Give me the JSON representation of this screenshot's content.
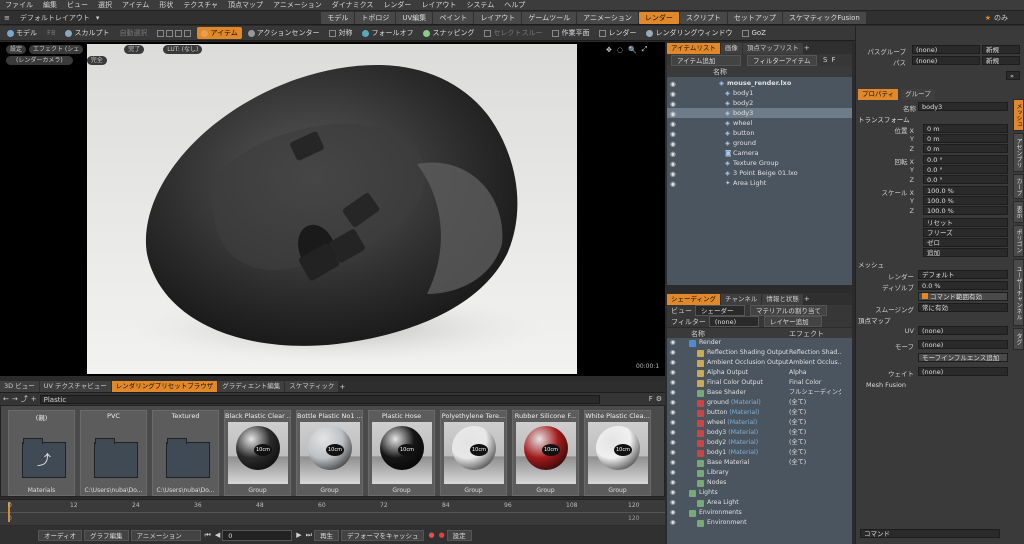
{
  "menubar": [
    "ファイル",
    "編集",
    "ビュー",
    "選択",
    "アイテム",
    "形状",
    "テクスチャ",
    "頂点マップ",
    "アニメーション",
    "ダイナミクス",
    "レンダー",
    "レイアウト",
    "システム",
    "ヘルプ"
  ],
  "layout": {
    "name": "デフォルトレイアウト",
    "tabs": [
      "モデル",
      "トポロジ",
      "UV編集",
      "ペイント",
      "レイアウト",
      "ゲームツール",
      "アニメーション",
      "レンダー",
      "スクリプト",
      "セットアップ",
      "スケマティックFusion"
    ],
    "active_tab": "レンダー",
    "right": "のみ"
  },
  "toolbar": {
    "model": "モデル",
    "f": "F8",
    "sculpt": "スカルプト",
    "auto": "自動選択",
    "item": "アイテム",
    "action_center": "アクションセンター",
    "symmetry": "対称",
    "falloff": "フォールオフ",
    "snapping": "スナッピング",
    "select_through": "セレクトスルー",
    "work_plane": "作業平面",
    "render": "レンダー",
    "render_window": "レンダリングウィンドウ",
    "goz": "GoZ"
  },
  "viewport": {
    "settings": "設定",
    "effect": "エフェクト (シェ",
    "complete": "完了",
    "lut": "LUT: (なし)",
    "camera": "(レンダーカメラ)",
    "full": "完全",
    "time": "00:00:1"
  },
  "bottom_tabs": [
    "3D ビュー",
    "UV テクスチャビュー",
    "レンダリングプリセットブラウザ",
    "グラディエント編集",
    "スケマティック"
  ],
  "bottom_active": "レンダリングプリセットブラウザ",
  "path": "Plastic",
  "presets": [
    {
      "title": "(親)",
      "caption": "Materials",
      "kind": "up"
    },
    {
      "title": "PVC",
      "caption": "C:\\Users\\nuba\\Do...",
      "kind": "folder"
    },
    {
      "title": "Textured",
      "caption": "C:\\Users\\nuba\\Do...",
      "kind": "folder"
    },
    {
      "title": "Black Plastic Clear ...",
      "caption": "Group",
      "kind": "sphere",
      "color": "#2a2a2a"
    },
    {
      "title": "Bottle Plastic No1 ...",
      "caption": "Group",
      "kind": "sphere",
      "color": "#bfc3c6"
    },
    {
      "title": "Plastic Hose",
      "caption": "Group",
      "kind": "sphere",
      "color": "#151515"
    },
    {
      "title": "Polyethylene Tere...",
      "caption": "Group",
      "kind": "sphere",
      "color": "#e8e8e8"
    },
    {
      "title": "Rubber Silicone F...",
      "caption": "Group",
      "kind": "sphere",
      "color": "#a11b1b"
    },
    {
      "title": "White Plastic Clea...",
      "caption": "Group",
      "kind": "sphere",
      "color": "#f0f0f0"
    }
  ],
  "thumb_label": "10cm",
  "timeline": {
    "ticks": [
      "0",
      "12",
      "24",
      "36",
      "48",
      "60",
      "72",
      "84",
      "96",
      "108",
      "120"
    ],
    "sub": [
      "0",
      "",
      "",
      "",
      "",
      "",
      "",
      "",
      "",
      "",
      "120"
    ]
  },
  "statusbar": {
    "audio": "オーディオ",
    "graph": "グラフ編集",
    "anim": "アニメーション",
    "frame": "0",
    "play": "再生",
    "cache": "デフォーマをキャッシュ",
    "settings": "設定"
  },
  "itemlist": {
    "tabs": [
      "アイテムリスト",
      "画像",
      "頂点マップリスト"
    ],
    "add": "アイテム追加",
    "filter": "フィルターアイテム",
    "col_name": "名称",
    "rows": [
      {
        "name": "mouse_render.lxo",
        "indent": 0,
        "bold": true
      },
      {
        "name": "body1",
        "indent": 1
      },
      {
        "name": "body2",
        "indent": 1
      },
      {
        "name": "body3",
        "indent": 1,
        "selected": true
      },
      {
        "name": "wheel",
        "indent": 1
      },
      {
        "name": "button",
        "indent": 1
      },
      {
        "name": "ground",
        "indent": 1
      },
      {
        "name": "Camera",
        "indent": 1
      },
      {
        "name": "Texture Group",
        "indent": 1
      },
      {
        "name": "3 Point Beige 01.lxo",
        "indent": 1
      },
      {
        "name": "Area Light",
        "indent": 1
      }
    ]
  },
  "shading": {
    "tabs": [
      "シェーディング",
      "チャンネル",
      "情報と状態"
    ],
    "view_lbl": "ビュー",
    "view": "シェーダーツリー",
    "assign": "マテリアルの割り当て",
    "filter_lbl": "フィルター",
    "filter": "(none)",
    "layer_add": "レイヤー追加",
    "col_name": "名称",
    "col_effect": "エフェクト",
    "rows": [
      {
        "name": "Render",
        "fx": "",
        "indent": 0
      },
      {
        "name": "Reflection Shading Output",
        "fx": "Reflection Shad...",
        "indent": 1
      },
      {
        "name": "Ambient Occlusion Output",
        "fx": "Ambient Occlus...",
        "indent": 1
      },
      {
        "name": "Alpha Output",
        "fx": "Alpha",
        "indent": 1
      },
      {
        "name": "Final Color Output",
        "fx": "Final Color",
        "indent": 1
      },
      {
        "name": "Base Shader",
        "fx": "フルシェーディング",
        "indent": 1
      },
      {
        "name": "ground",
        "mat": "(Material)",
        "fx": "(全て)",
        "indent": 1
      },
      {
        "name": "button",
        "mat": "(Material)",
        "fx": "(全て)",
        "indent": 1
      },
      {
        "name": "wheel",
        "mat": "(Material)",
        "fx": "(全て)",
        "indent": 1
      },
      {
        "name": "body3",
        "mat": "(Material)",
        "fx": "(全て)",
        "indent": 1
      },
      {
        "name": "body2",
        "mat": "(Material)",
        "fx": "(全て)",
        "indent": 1
      },
      {
        "name": "body1",
        "mat": "(Material)",
        "fx": "(全て)",
        "indent": 1
      },
      {
        "name": "Base Material",
        "fx": "(全て)",
        "indent": 1
      },
      {
        "name": "Library",
        "fx": "",
        "indent": 1
      },
      {
        "name": "Nodes",
        "fx": "",
        "indent": 1
      },
      {
        "name": "Lights",
        "fx": "",
        "indent": 0
      },
      {
        "name": "Area Light",
        "fx": "",
        "indent": 1
      },
      {
        "name": "Environments",
        "fx": "",
        "indent": 0
      },
      {
        "name": "Environment",
        "fx": "",
        "indent": 1
      }
    ]
  },
  "props": {
    "pass_group_lbl": "パスグループ",
    "pass_group": "(none)",
    "new1": "新規",
    "pass_lbl": "パス",
    "pass": "(none)",
    "new2": "新規",
    "tabs": [
      "プロパティ",
      "グループ"
    ],
    "name_lbl": "名称",
    "name": "body3",
    "transform": "トランスフォーム",
    "pos_lbl": "位置 X",
    "pos": [
      "0 m",
      "0 m",
      "0 m"
    ],
    "rot_lbl": "回転 X",
    "rot": [
      "0.0 °",
      "0.0 °",
      "0.0 °"
    ],
    "scale_lbl": "スケール X",
    "scale": [
      "100.0 %",
      "100.0 %",
      "100.0 %"
    ],
    "y": "Y",
    "z": "Z",
    "reset": "リセット",
    "freeze": "フリーズ",
    "zero": "ゼロ",
    "add": "追加",
    "mesh": "メッシュ",
    "render_lbl": "レンダー",
    "render": "デフォルト",
    "subdiv_lbl": "ディゾルブ",
    "subdiv": "0.0 %",
    "cmd_subdiv": "コマンド範囲有効",
    "smooth_lbl": "スムージング",
    "smooth": "常に有効",
    "vmap": "頂点マップ",
    "uv_lbl": "UV",
    "uv": "(none)",
    "morph_lbl": "モーフ",
    "morph": "(none)",
    "morph_add": "モーフインフルエンス追加",
    "weight_lbl": "ウェイト",
    "weight": "(none)",
    "mesh_fusion": "Mesh Fusion",
    "vtabs": [
      "メッシュ",
      "アセンブリ",
      "カーブ",
      "表示",
      "ポリゴン",
      "ユーザーチャンネル",
      "タグ"
    ],
    "command": "コマンド"
  }
}
